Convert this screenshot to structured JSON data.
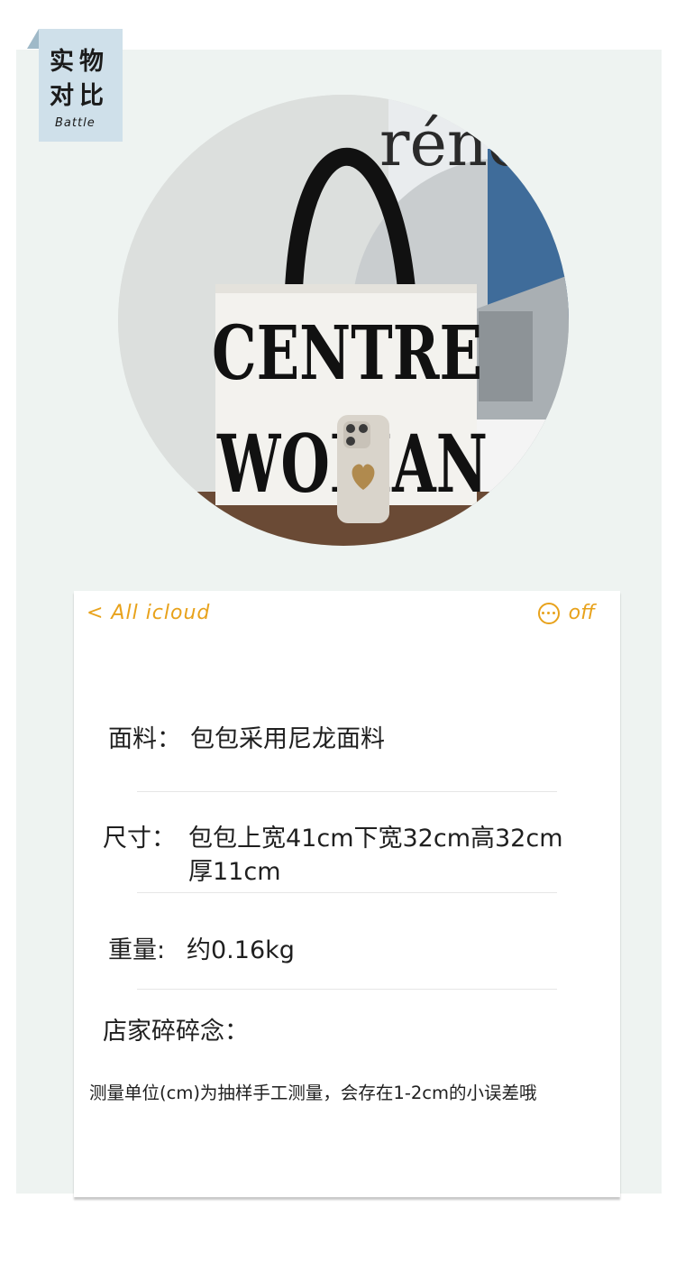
{
  "badge": {
    "line1": "实物",
    "line2": "对比",
    "sub": "Battle"
  },
  "photo": {
    "bag_text_line1": "CENTRE",
    "bag_text_line2": "WOMAN",
    "background_text": "rénc"
  },
  "nav": {
    "back_label": "< All icloud",
    "right_label": "off"
  },
  "specs": [
    {
      "label": "面料：",
      "value": "包包采用尼龙面料"
    },
    {
      "label": "尺寸：",
      "value": "包包上宽41cm下宽32cm高32cm厚11cm"
    },
    {
      "label": "重量:",
      "value": "约0.16kg"
    }
  ],
  "notes": {
    "heading": "店家碎碎念：",
    "text": "测量单位(cm)为抽样手工测量，会存在1-2cm的小误差哦"
  },
  "colors": {
    "accent": "#e8a21b",
    "panel": "#eef3f1",
    "badge": "#cfe0ea"
  }
}
